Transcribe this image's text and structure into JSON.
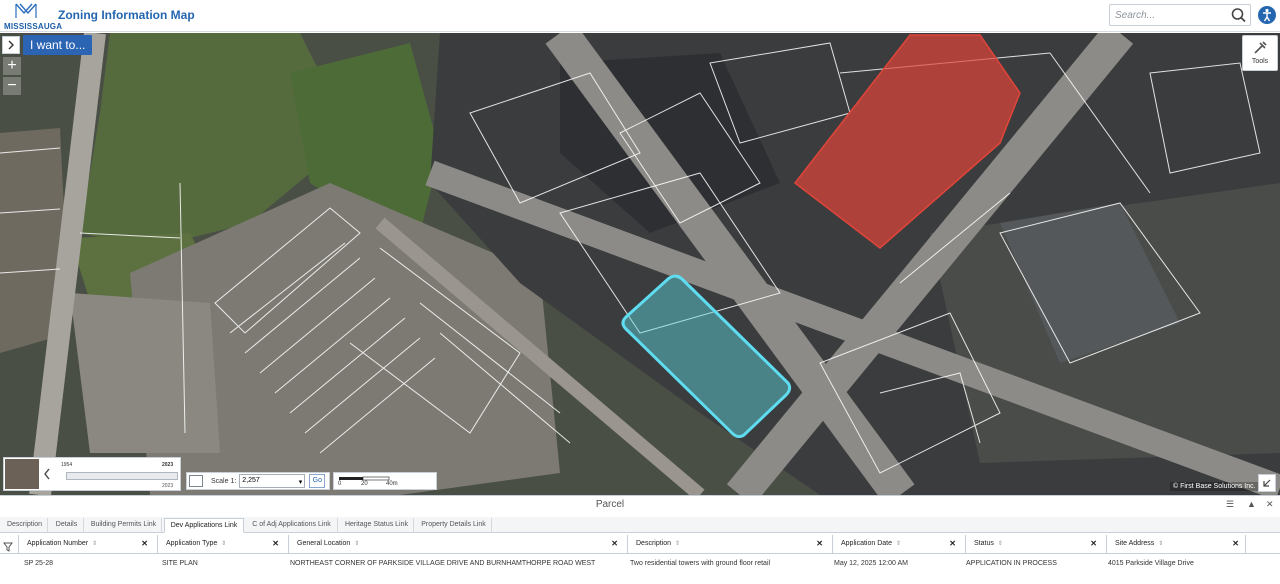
{
  "header": {
    "logo_text": "MISSISSAUGA",
    "title": "Zoning Information Map",
    "search_placeholder": "Search..."
  },
  "map": {
    "iwant_label": "I want to...",
    "zoom_in": "+",
    "zoom_out": "−",
    "tools_label": "Tools",
    "timeline": {
      "start_year": "1954",
      "end_year": "2023",
      "current_year": "2023"
    },
    "scale": {
      "label": "Scale 1:",
      "value": "2,257",
      "go_label": "Go"
    },
    "scalebar": {
      "tick0": "0",
      "tick1": "20",
      "tick2": "40m"
    },
    "attribution": "© First Base Solutions Inc."
  },
  "panel": {
    "title": "Parcel",
    "tabs": [
      "Description",
      "Details",
      "Building Permits Link",
      "Dev Applications Link",
      "C of Adj Applications Link",
      "Heritage Status Link",
      "Property Details Link"
    ],
    "active_tab": "Dev Applications Link",
    "columns": [
      "Application Number",
      "Application Type",
      "General Location",
      "Description",
      "Application Date",
      "Status",
      "Site Address"
    ],
    "rows": [
      [
        "SP 25-28",
        "SITE PLAN",
        "NORTHEAST CORNER OF PARKSIDE VILLAGE DRIVE AND BURNHAMTHORPE ROAD WEST",
        "Two residential towers with ground floor retail",
        "May 12, 2025 12:00 AM",
        "APPLICATION IN PROCESS",
        "4015 Parkside Village Drive"
      ]
    ]
  },
  "colors": {
    "brand_blue": "#2566b0",
    "selected_parcel": "#5ed6e0",
    "highlight_parcel": "#e0453a"
  }
}
